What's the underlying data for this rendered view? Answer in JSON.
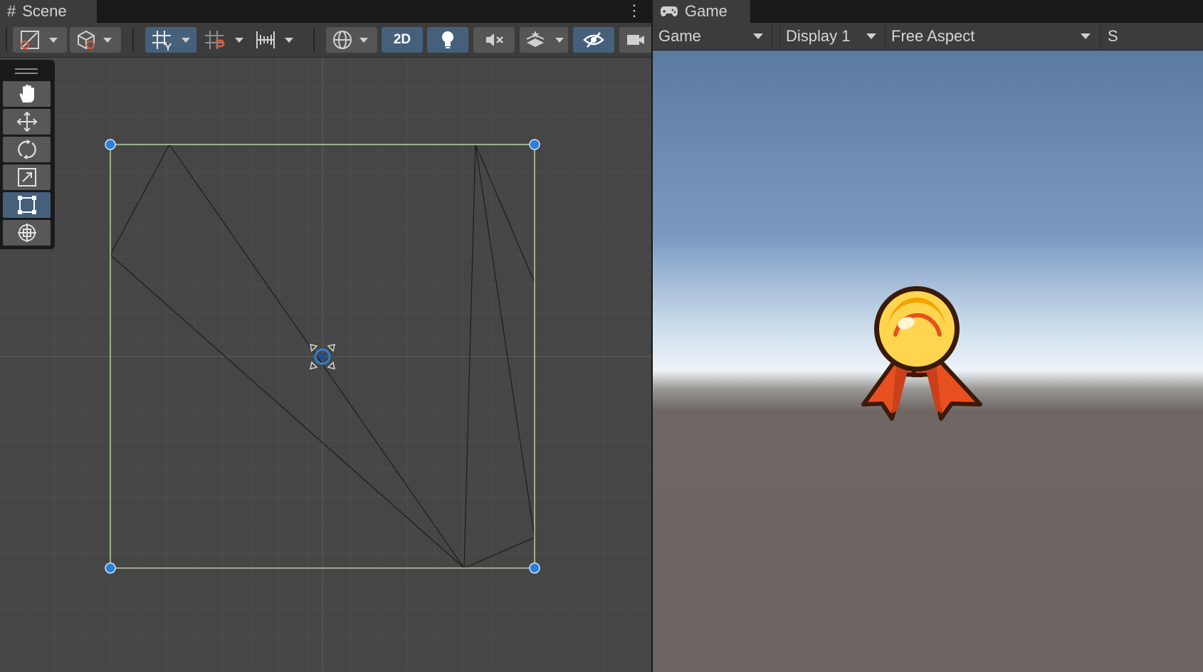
{
  "scene": {
    "tab_title": "Scene",
    "tab_icon": "grid-hash-icon",
    "more_icon": "vertical-ellipsis-icon",
    "toolbar": {
      "draw_mode_icon": "shading-mode-icon",
      "render_mode_icon": "cube-icon",
      "grid_snap_icon": "grid-snap-icon",
      "increment_snap_icon": "increment-snap-icon",
      "ruler_icon": "ruler-icon",
      "gizmo_icon": "globe-icon",
      "mode_2d_label": "2D",
      "light_icon": "lightbulb-icon",
      "audio_icon": "audio-mute-icon",
      "effects_icon": "effects-stack-icon",
      "visibility_icon": "eye-hidden-icon",
      "camera_icon": "camera-icon"
    },
    "tools": [
      "hand-tool",
      "move-tool",
      "rotate-tool",
      "scale-tool",
      "rect-tool",
      "transform-tool"
    ],
    "active_tool": "rect-tool",
    "colors": {
      "selection_outline": "#c8e6b4",
      "handle": "#2d7fd9",
      "active_button": "#46607c"
    }
  },
  "game": {
    "tab_title": "Game",
    "tab_icon": "gamepad-icon",
    "camera_select": "Game",
    "display_select": "Display 1",
    "aspect_select": "Free Aspect",
    "scale_label_partial": "S",
    "colors": {
      "sky_top": "#5a7aa0",
      "horizon": "#eef3f8",
      "ground": "#6c6460",
      "medal_gold": "#ffd54f",
      "ribbon": "#e85020"
    }
  }
}
